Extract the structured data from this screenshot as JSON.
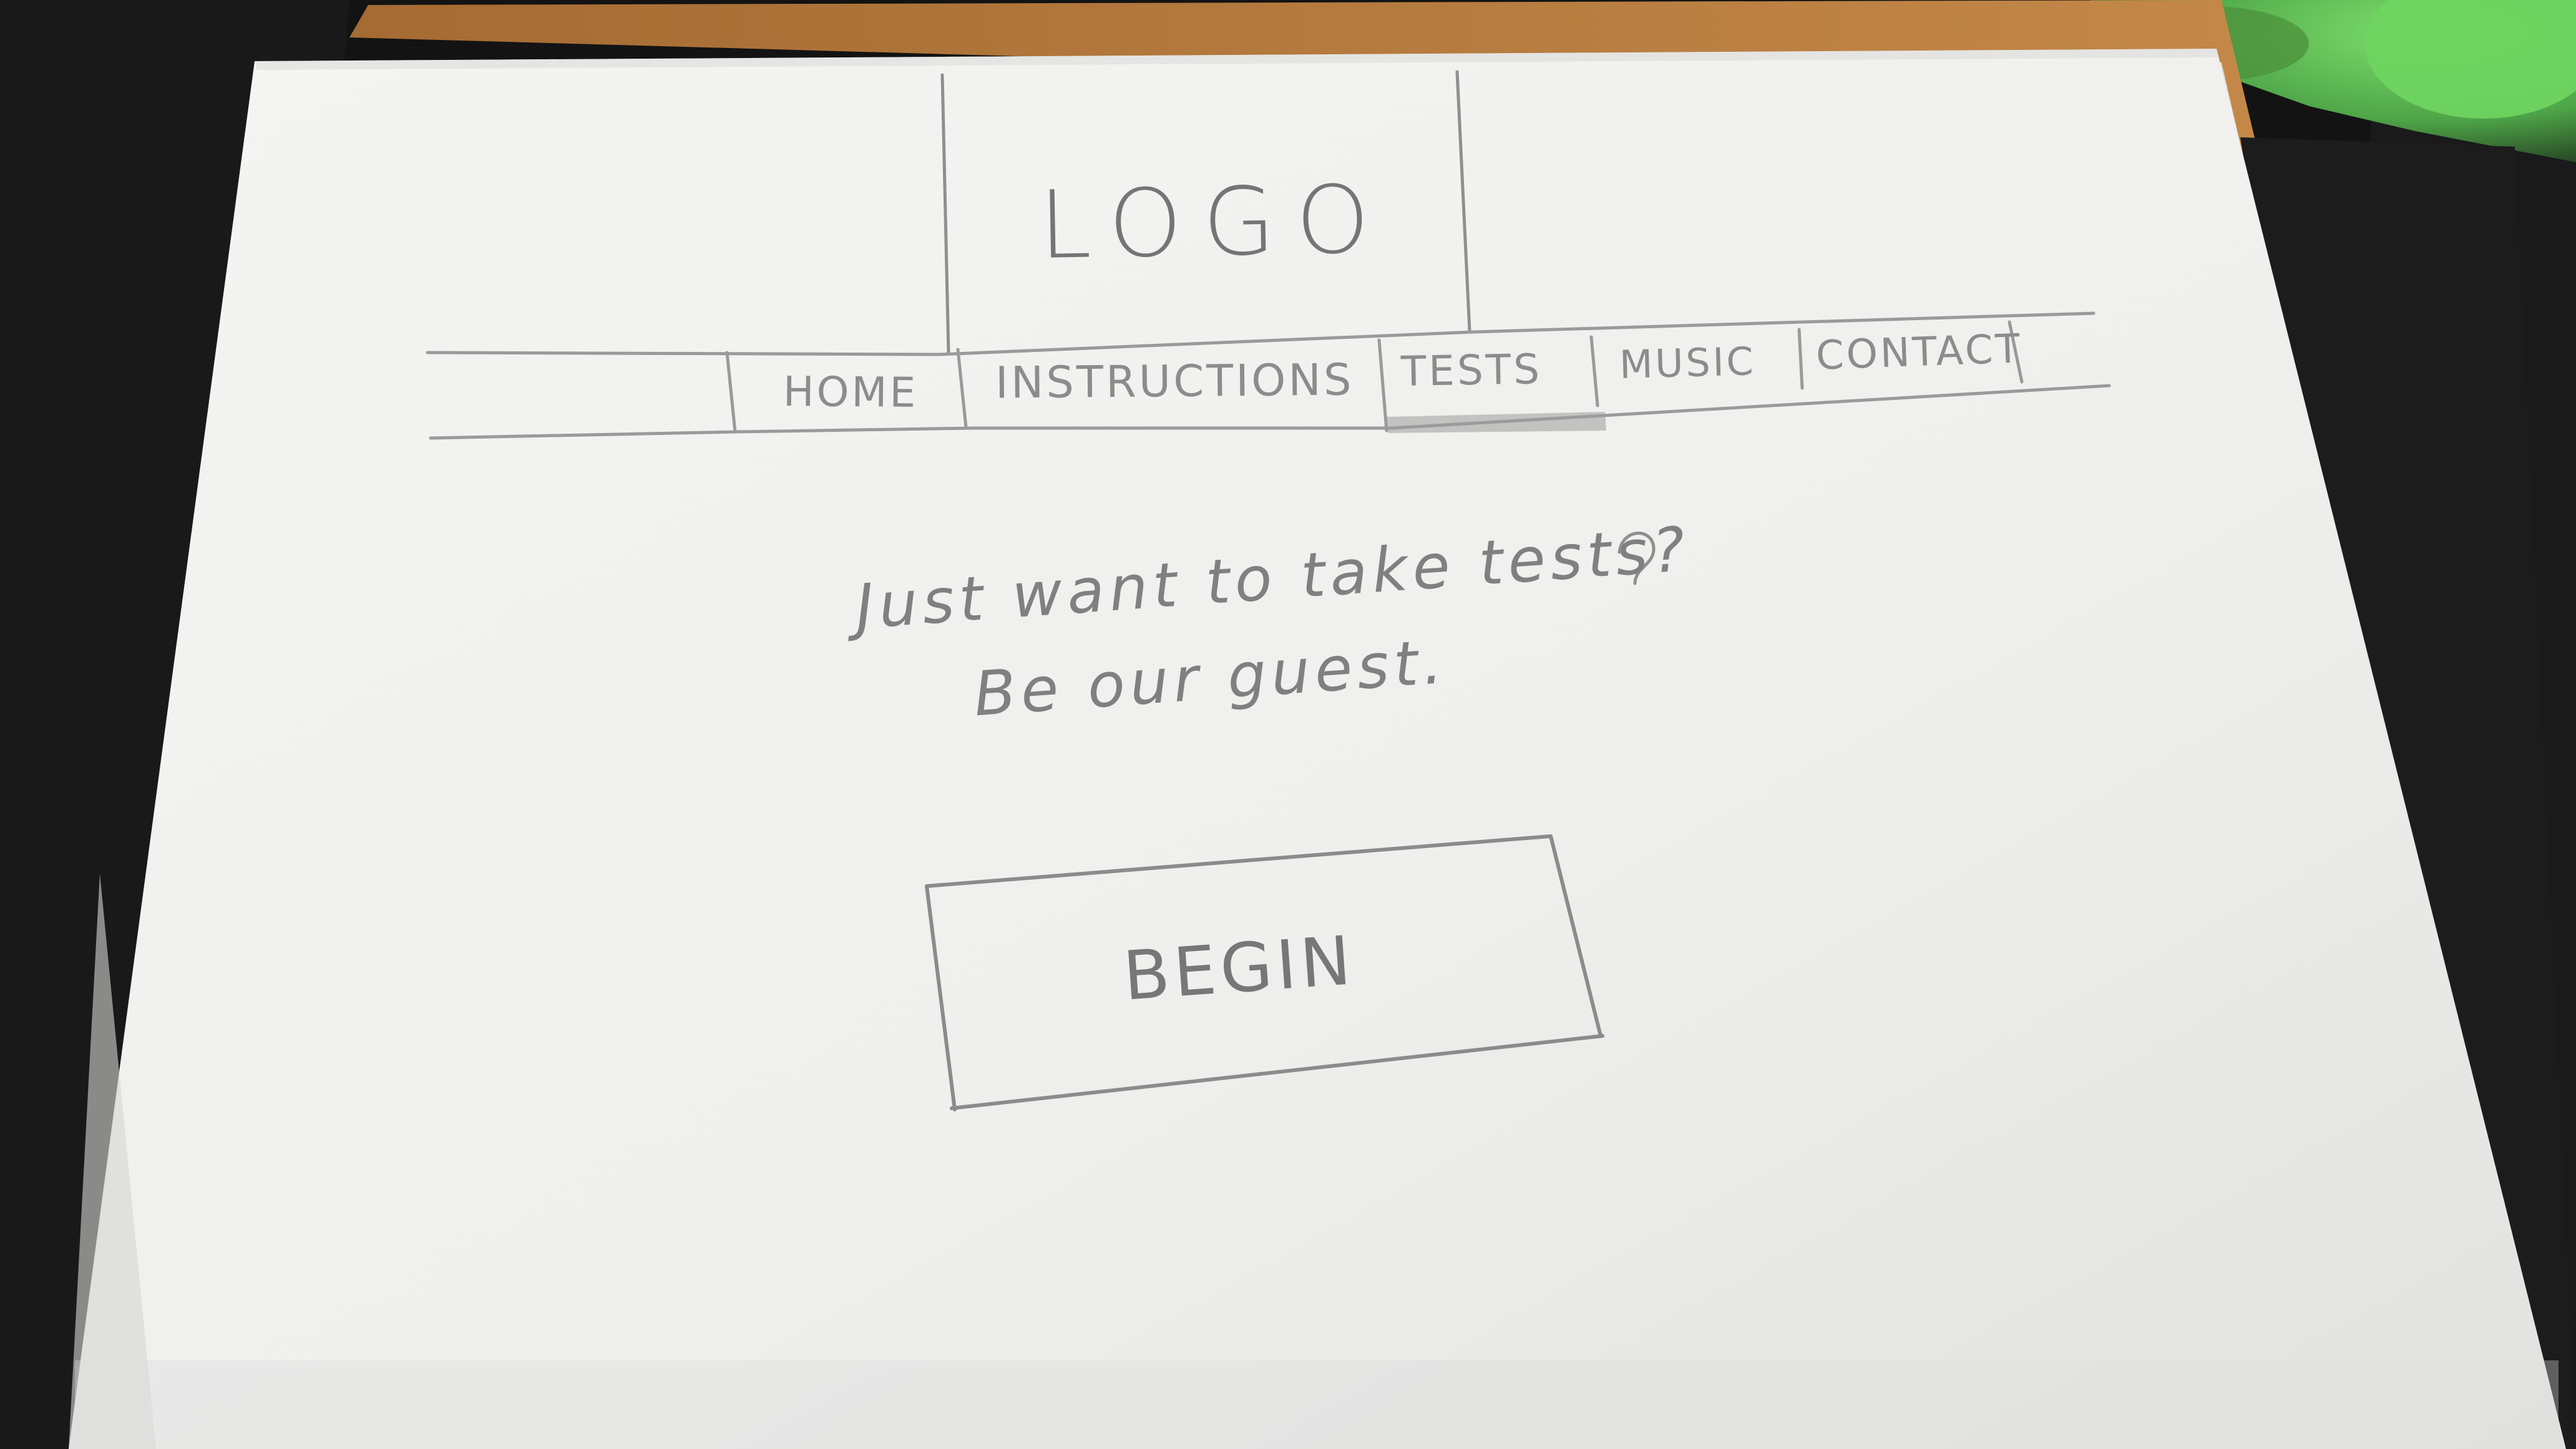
{
  "sketch": {
    "logo": "LOGO",
    "nav": {
      "items": [
        {
          "label": "HOME"
        },
        {
          "label": "INSTRUCTIONS"
        },
        {
          "label": "TESTS"
        },
        {
          "label": "MUSIC"
        },
        {
          "label": "CONTACT"
        }
      ],
      "active_index": 2
    },
    "hero": {
      "line1": "Just want to take tests?",
      "line2": "Be our guest."
    },
    "button": {
      "label": "BEGIN"
    }
  },
  "colors": {
    "background": "#121212",
    "paper": "#f1f1ef",
    "cardboard": "#b77f3f",
    "pencil": "#8a8a8a",
    "green_object": "#62c957"
  }
}
